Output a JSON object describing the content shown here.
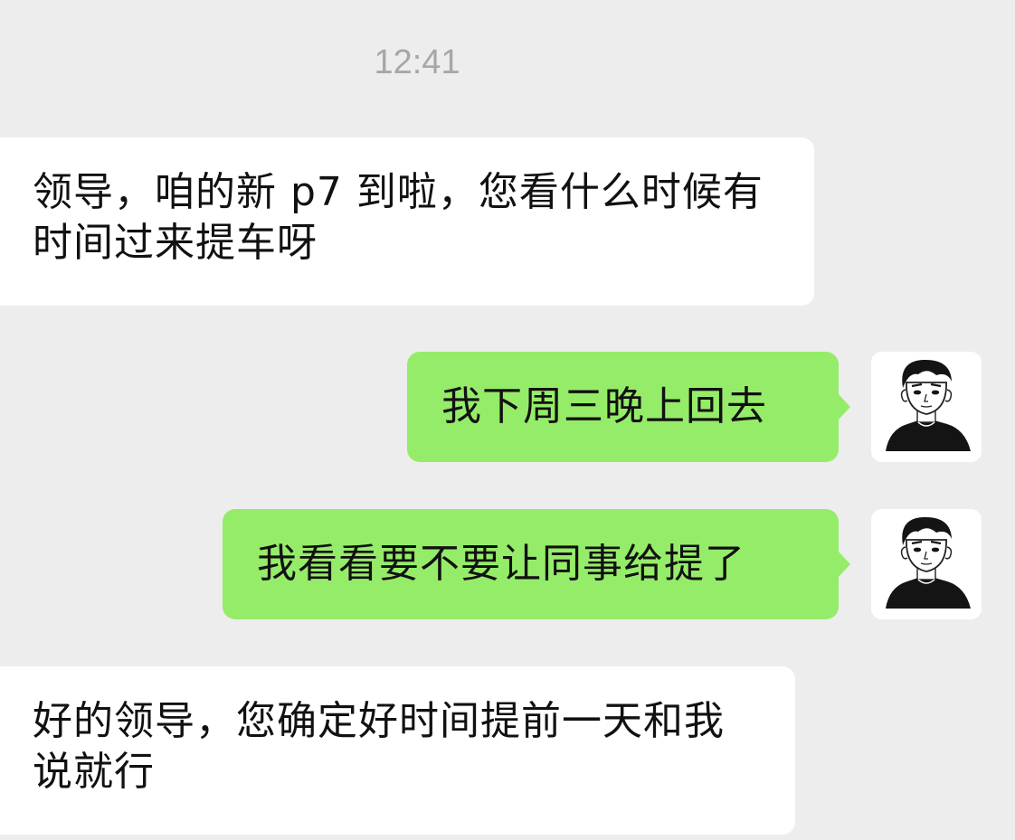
{
  "chat": {
    "timestamp": "12:41",
    "accent_color": "#95ec69",
    "messages": [
      {
        "sender": "other",
        "text": "领导，咱的新 p7 到啦，您看什么时候有时间过来提车呀"
      },
      {
        "sender": "self",
        "text": "我下周三晚上回去"
      },
      {
        "sender": "self",
        "text": "我看看要不要让同事给提了"
      },
      {
        "sender": "other",
        "text": "好的领导，您确定好时间提前一天和我说就行"
      }
    ]
  },
  "icons": {
    "self_avatar": "cartoon-person-avatar-icon"
  }
}
